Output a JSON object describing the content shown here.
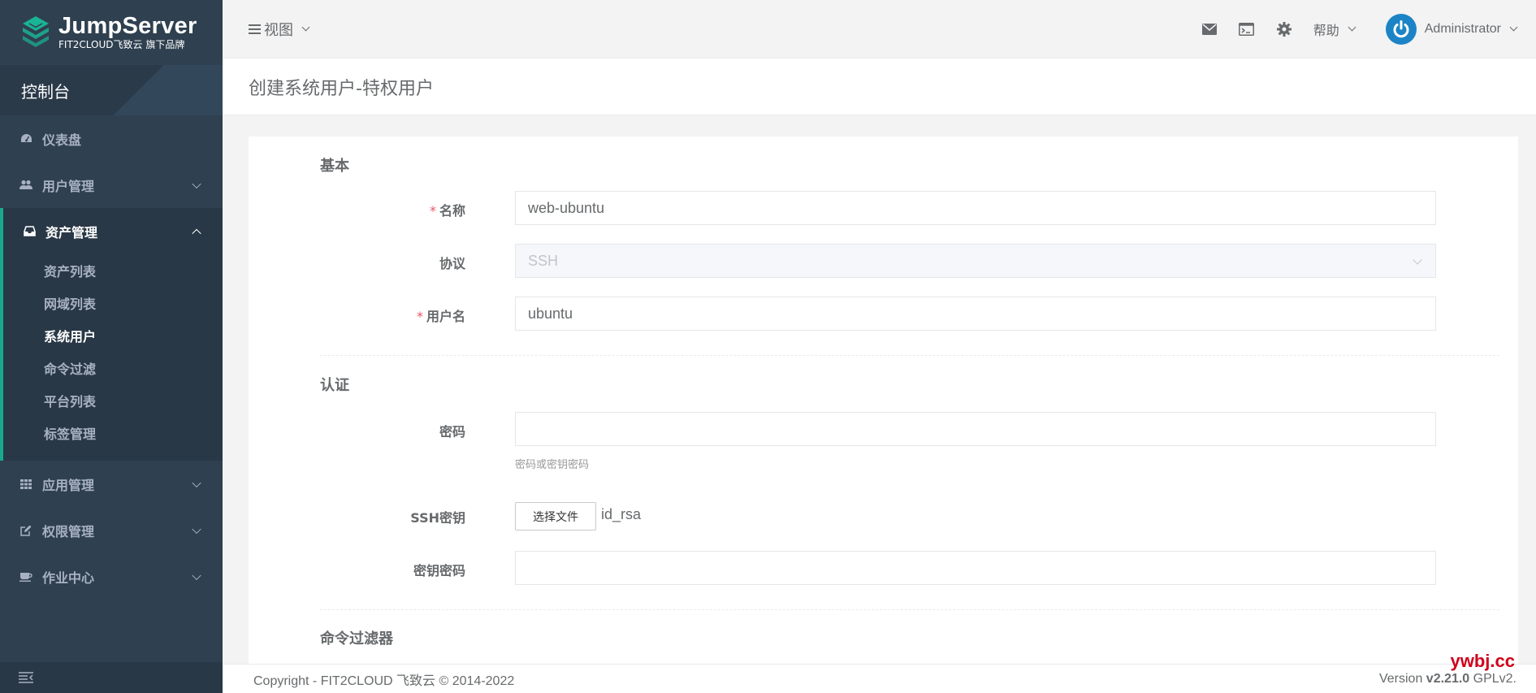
{
  "app": {
    "logo_title": "JumpServer",
    "logo_subtitle": "FIT2CLOUD飞致云 旗下品牌",
    "console_label": "控制台"
  },
  "sidebar": {
    "items": [
      {
        "label": "仪表盘",
        "icon": "dashboard-icon"
      },
      {
        "label": "用户管理",
        "icon": "users-icon"
      },
      {
        "label": "资产管理",
        "icon": "inbox-icon",
        "expanded": true,
        "children": [
          {
            "label": "资产列表"
          },
          {
            "label": "网域列表"
          },
          {
            "label": "系统用户",
            "active": true
          },
          {
            "label": "命令过滤"
          },
          {
            "label": "平台列表"
          },
          {
            "label": "标签管理"
          }
        ]
      },
      {
        "label": "应用管理",
        "icon": "grid-icon"
      },
      {
        "label": "权限管理",
        "icon": "edit-icon"
      },
      {
        "label": "作业中心",
        "icon": "coffee-icon"
      }
    ]
  },
  "topbar": {
    "view_label": "视图",
    "help_label": "帮助",
    "user_name": "Administrator"
  },
  "page": {
    "title": "创建系统用户-特权用户"
  },
  "form": {
    "sections": {
      "basic": "基本",
      "auth": "认证",
      "filters": "命令过滤器"
    },
    "name_label": "名称",
    "name_value": "web-ubuntu",
    "protocol_label": "协议",
    "protocol_value": "SSH",
    "username_label": "用户名",
    "username_value": "ubuntu",
    "password_label": "密码",
    "password_value": "",
    "password_help": "密码或密钥密码",
    "sshkey_label": "SSH密钥",
    "file_button_label": "选择文件",
    "file_name": "id_rsa",
    "passphrase_label": "密钥密码",
    "passphrase_value": ""
  },
  "footer": {
    "copyright": "Copyright - FIT2CLOUD 飞致云 © 2014-2022",
    "version_prefix": "Version ",
    "version_number": "v2.21.0",
    "version_suffix": " GPLv2."
  },
  "watermark": "ywbj.cc",
  "colors": {
    "sidebar_bg": "#2f4050",
    "accent": "#19aa8d",
    "avatar": "#1c84c6",
    "required": "#ed5565"
  }
}
